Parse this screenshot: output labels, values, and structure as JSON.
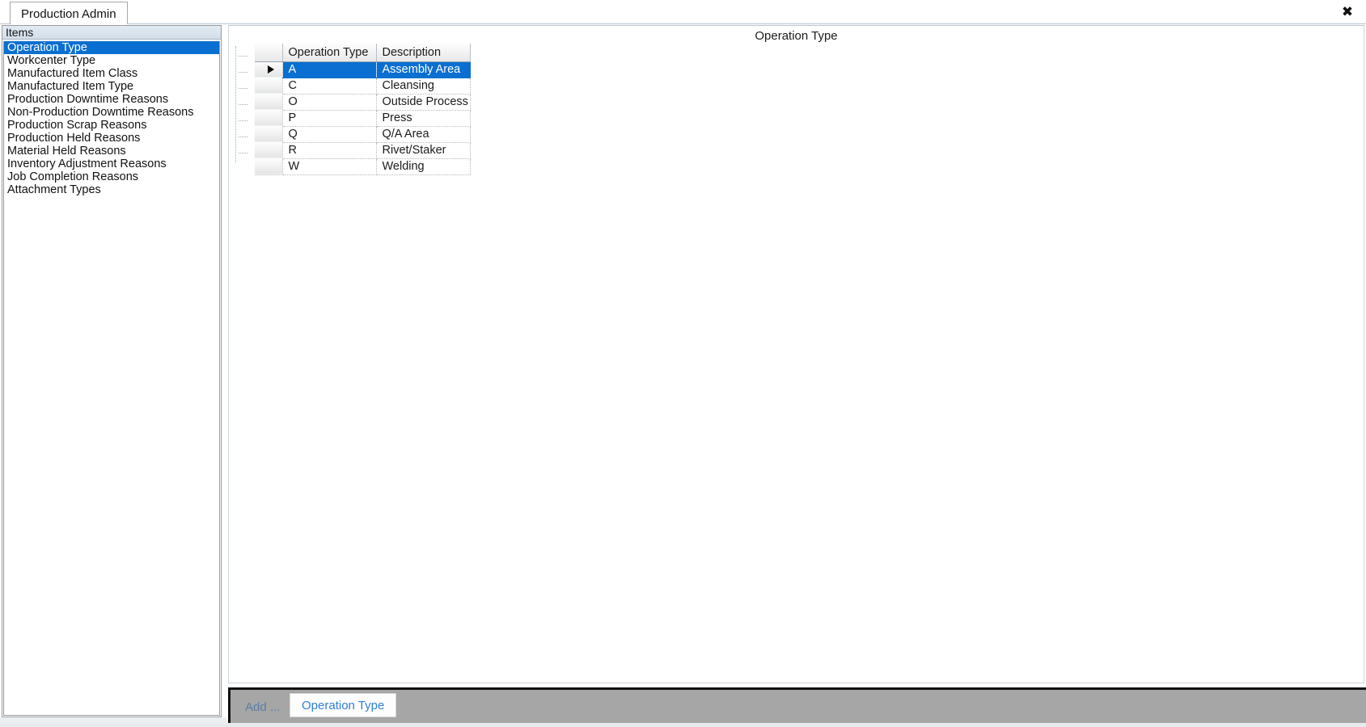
{
  "window": {
    "close_icon": "close-icon",
    "close_glyph": "✖"
  },
  "tabs": [
    {
      "label": "Production Admin",
      "active": true
    }
  ],
  "sidebar": {
    "header": "Items",
    "items": [
      {
        "label": "Operation Type",
        "selected": true
      },
      {
        "label": "Workcenter Type",
        "selected": false
      },
      {
        "label": "Manufactured Item Class",
        "selected": false
      },
      {
        "label": "Manufactured Item Type",
        "selected": false
      },
      {
        "label": "Production Downtime Reasons",
        "selected": false
      },
      {
        "label": "Non-Production Downtime Reasons",
        "selected": false
      },
      {
        "label": "Production Scrap Reasons",
        "selected": false
      },
      {
        "label": "Production Held Reasons",
        "selected": false
      },
      {
        "label": "Material Held Reasons",
        "selected": false
      },
      {
        "label": "Inventory Adjustment Reasons",
        "selected": false
      },
      {
        "label": "Job Completion Reasons",
        "selected": false
      },
      {
        "label": "Attachment Types",
        "selected": false
      }
    ]
  },
  "main": {
    "title": "Operation Type",
    "grid": {
      "columns": [
        "Operation Type",
        "Description"
      ],
      "rows": [
        {
          "code": "A",
          "description": "Assembly Area",
          "selected": true
        },
        {
          "code": "C",
          "description": "Cleansing",
          "selected": false
        },
        {
          "code": "O",
          "description": "Outside Process",
          "selected": false
        },
        {
          "code": "P",
          "description": "Press",
          "selected": false
        },
        {
          "code": "Q",
          "description": "Q/A Area",
          "selected": false
        },
        {
          "code": "R",
          "description": "Rivet/Staker",
          "selected": false
        },
        {
          "code": "W",
          "description": "Welding",
          "selected": false
        }
      ]
    }
  },
  "bottom_bar": {
    "add_label": "Add ...",
    "button_label": "Operation Type"
  },
  "colors": {
    "selection_blue": "#0a6fd0",
    "bottom_bar_gray": "#a6a6a6",
    "link_blue": "#2f7fd8",
    "muted_blue": "#5b7fa6"
  }
}
